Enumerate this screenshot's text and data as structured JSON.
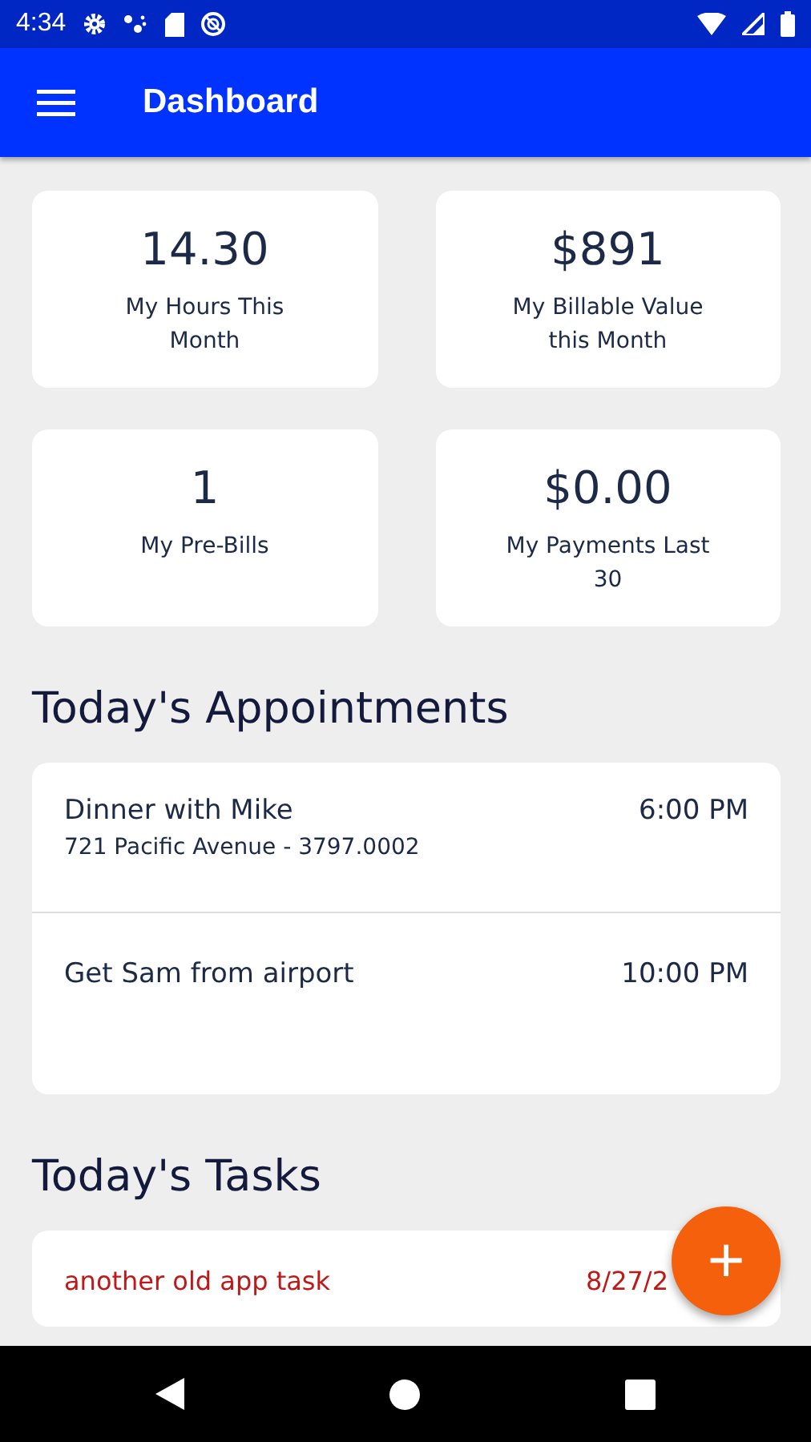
{
  "status_bar": {
    "time": "4:34"
  },
  "app_bar": {
    "title": "Dashboard"
  },
  "stats": [
    {
      "value": "14.30",
      "label": "My Hours This Month"
    },
    {
      "value": "$891",
      "label": "My Billable Value this Month"
    },
    {
      "value": "1",
      "label": "My Pre-Bills"
    },
    {
      "value": "$0.00",
      "label": "My Payments Last 30"
    }
  ],
  "appointments": {
    "title": "Today's Appointments",
    "items": [
      {
        "title": "Dinner with Mike",
        "detail": "721 Pacific Avenue - 3797.0002",
        "time": "6:00 PM"
      },
      {
        "title": "Get Sam from airport",
        "time": "10:00 PM"
      }
    ]
  },
  "tasks": {
    "title": "Today's Tasks",
    "items": [
      {
        "title": "another old app task",
        "date": "8/27/2"
      }
    ]
  },
  "fab": {
    "label": "+"
  }
}
